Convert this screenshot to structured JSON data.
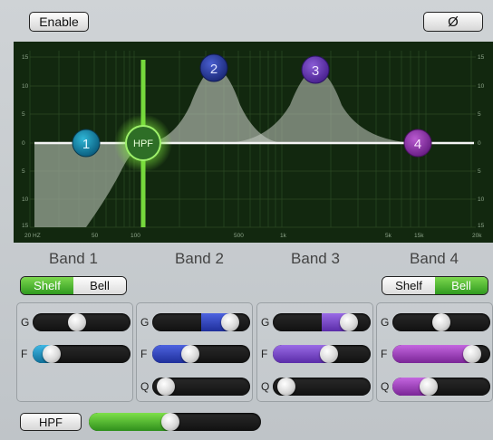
{
  "toolbar": {
    "enable_label": "Enable",
    "phase_label": "Ø"
  },
  "graph": {
    "y_ticks": [
      "15",
      "10",
      "5",
      "0",
      "5",
      "10",
      "15"
    ],
    "x_ticks": [
      "20 HZ",
      "50",
      "100",
      "500",
      "1k",
      "5k",
      "15k",
      "20k"
    ],
    "hpf_label": "HPF",
    "nodes": [
      "1",
      "2",
      "3",
      "4"
    ]
  },
  "bands": [
    {
      "label": "Band 1",
      "shelf": "Shelf",
      "bell": "Bell",
      "mode": "shelf"
    },
    {
      "label": "Band 2"
    },
    {
      "label": "Band 3"
    },
    {
      "label": "Band 4",
      "shelf": "Shelf",
      "bell": "Bell",
      "mode": "bell"
    }
  ],
  "controls": {
    "g_label": "G",
    "f_label": "F",
    "q_label": "Q",
    "band1": {
      "gain": 0.44,
      "freq": 0.12
    },
    "band2": {
      "gain": 0.86,
      "freq": 0.36,
      "q": 0.06
    },
    "band3": {
      "gain": 0.84,
      "freq": 0.59,
      "q": 0.06
    },
    "band4": {
      "gain": 0.5,
      "freq": 0.89,
      "q": 0.34
    }
  },
  "hpf": {
    "label": "HPF",
    "level": 0.47
  },
  "colors": {
    "graph_bg": "#12280f",
    "hpf_green": "#5fcf3a",
    "band1": "#1f8fb0",
    "band2": "#2b3fa6",
    "band3": "#6a3cb0",
    "band4": "#8a35a0"
  }
}
